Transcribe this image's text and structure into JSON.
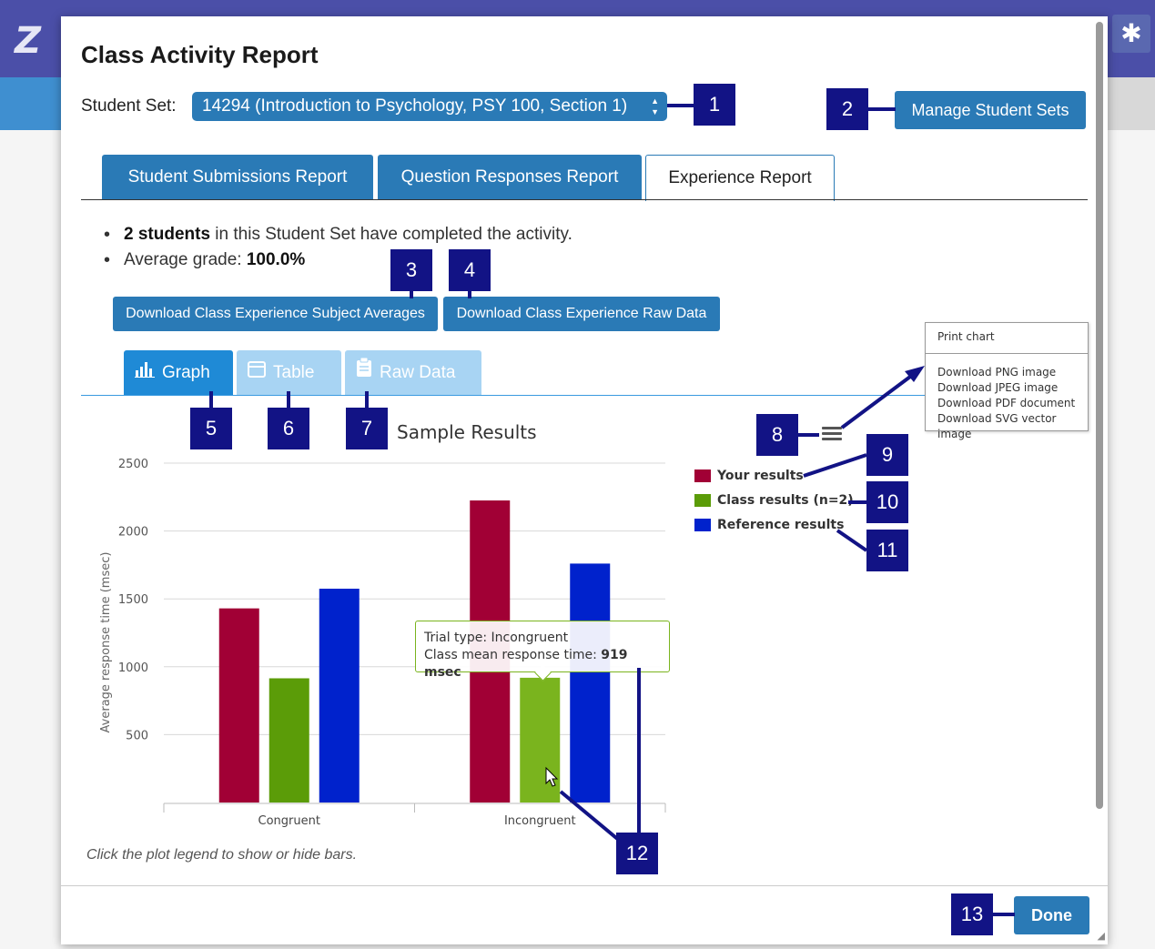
{
  "app": {
    "logo": "Z",
    "gear_icon": "✱"
  },
  "modal": {
    "title": "Class Activity Report",
    "student_set_label": "Student Set:",
    "student_set_value": "14294 (Introduction to Psychology, PSY 100, Section 1)",
    "manage_button": "Manage Student Sets",
    "report_tabs": [
      "Student Submissions Report",
      "Question Responses Report",
      "Experience Report"
    ],
    "active_report_tab": "Experience Report",
    "summary": {
      "students_bold": "2 students",
      "students_text": " in this Student Set have completed the activity.",
      "grade_label": "Average grade: ",
      "grade_value": "100.0%"
    },
    "download_subject_button": "Download Class Experience Subject Averages",
    "download_raw_button": "Download Class Experience Raw Data",
    "view_tabs": [
      "Graph",
      "Table",
      "Raw Data"
    ],
    "active_view_tab": "Graph",
    "note": "Click the plot legend to show or hide bars.",
    "done_button": "Done"
  },
  "export_menu": {
    "print": "Print chart",
    "items": [
      "Download PNG image",
      "Download JPEG image",
      "Download PDF document",
      "Download SVG vector image"
    ]
  },
  "tooltip": {
    "line1": "Trial type: Incongruent",
    "line2_label": "Class mean response time: ",
    "line2_value": "919 msec"
  },
  "callouts": [
    "1",
    "2",
    "3",
    "4",
    "5",
    "6",
    "7",
    "8",
    "9",
    "10",
    "11",
    "12",
    "13"
  ],
  "colors": {
    "primary": "#2a7ab6",
    "callout": "#121385",
    "your": "#a10035",
    "class": "#5b9c08",
    "class_hover": "#7ab41e",
    "reference": "#0022cc"
  },
  "chart_data": {
    "type": "bar",
    "title": "Sample Results",
    "xlabel": "",
    "ylabel": "Average response time (msec)",
    "categories": [
      "Congruent",
      "Incongruent"
    ],
    "y_ticks": [
      500,
      1000,
      1500,
      2000,
      2500
    ],
    "ylim": [
      0,
      2500
    ],
    "series": [
      {
        "name": "Your results",
        "values": [
          1430,
          2225
        ]
      },
      {
        "name": "Class results (n=2)",
        "values": [
          915,
          919
        ]
      },
      {
        "name": "Reference results",
        "values": [
          1575,
          1760
        ]
      }
    ],
    "grid": true,
    "legend": "right"
  }
}
